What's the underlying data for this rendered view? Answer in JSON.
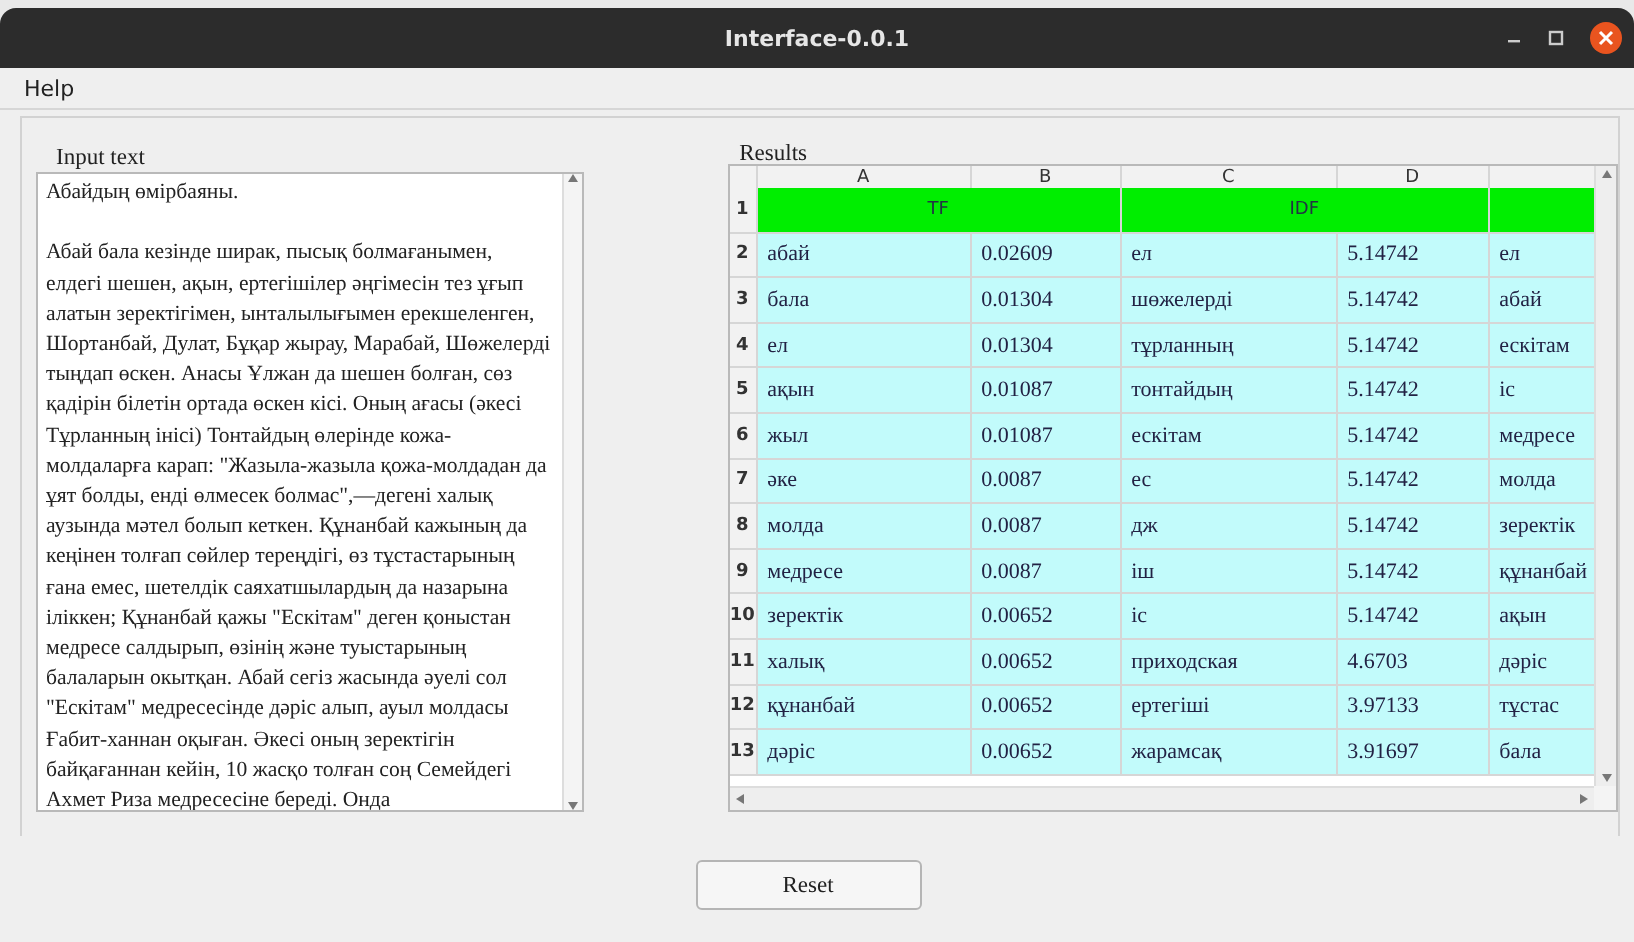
{
  "window": {
    "title": "Interface-0.0.1"
  },
  "menu": [
    "Help"
  ],
  "input_text": {
    "label": "Input text",
    "value": "Абайдың өмірбаяны.\n\nАбай бала кезінде ширак, пысық болмағанымен, елдегі шешен, ақын, ертегішілер әңгімесін тез ұғып алатын зеректігімен, ынталылығымен ерекшеленген, Шортанбай, Дулат, Бұқар жырау, Марабай, Шөжелерді тыңдап өскен. Анасы Ұлжан да шешен болған, сөз қадірін білетін ортада өскен кісі. Оның ағасы (әкесі Тұрланның інісі) Тонтайдың өлерінде кожа-молдаларға карап: \"Жазыла-жазыла қожа-молдадан да ұят болды, енді өлмесек болмас\",—дегені халық аузында мәтел болып кеткен. Құнанбай кажының да кеңінен толғап сөйлер тереңдігі, өз тұстастарының ғана емес, шетелдік саяхатшылардың да назарына іліккен; Құнанбай қажы \"Ескітам\" деген қоныстан медресе салдырып, өзінің және туыстарының балаларын окытқан. Абай сегіз жасында әуелі сол \"Ескітам\" медресесінде дәріс алып, ауыл молдасы Ғабит-ханнан оқыған. Әкесі оның зеректігін байқағаннан кейін, 10 жасқо толған соң Семейдегі Ахмет Риза медресесіне береді. Онда"
  },
  "results": {
    "label": "Results",
    "columns": [
      "A",
      "B",
      "C",
      "D"
    ],
    "rows": [
      {
        "number": "1",
        "kind": "merged",
        "cells": [
          "TF",
          "IDF"
        ]
      },
      {
        "number": "2",
        "kind": "data",
        "cells": [
          "абай",
          "0.02609",
          "ел",
          "5.14742",
          "ел"
        ]
      },
      {
        "number": "3",
        "kind": "data",
        "cells": [
          "бала",
          "0.01304",
          "шөжелерді",
          "5.14742",
          "абай"
        ]
      },
      {
        "number": "4",
        "kind": "data",
        "cells": [
          "ел",
          "0.01304",
          "тұрланның",
          "5.14742",
          "ескітам"
        ]
      },
      {
        "number": "5",
        "kind": "data",
        "cells": [
          "ақын",
          "0.01087",
          "тонтайдың",
          "5.14742",
          "іс"
        ]
      },
      {
        "number": "6",
        "kind": "data",
        "cells": [
          "жыл",
          "0.01087",
          "ескітам",
          "5.14742",
          "медресе"
        ]
      },
      {
        "number": "7",
        "kind": "data",
        "cells": [
          "әке",
          "0.0087",
          "ес",
          "5.14742",
          "молда"
        ]
      },
      {
        "number": "8",
        "kind": "data",
        "cells": [
          "молда",
          "0.0087",
          "дж",
          "5.14742",
          "зеректік"
        ]
      },
      {
        "number": "9",
        "kind": "data",
        "cells": [
          "медресе",
          "0.0087",
          "іш",
          "5.14742",
          "құнанбай"
        ]
      },
      {
        "number": "10",
        "kind": "data",
        "cells": [
          "зеректік",
          "0.00652",
          "іс",
          "5.14742",
          "ақын"
        ]
      },
      {
        "number": "11",
        "kind": "data",
        "cells": [
          "халық",
          "0.00652",
          "приходская",
          "4.6703",
          "дәріс"
        ]
      },
      {
        "number": "12",
        "kind": "data",
        "cells": [
          "құнанбай",
          "0.00652",
          "ертегіші",
          "3.97133",
          "тұстас"
        ]
      },
      {
        "number": "13",
        "kind": "data",
        "cells": [
          "дәріс",
          "0.00652",
          "жарамсақ",
          "3.91697",
          "бала"
        ]
      }
    ]
  },
  "button": "Reset"
}
